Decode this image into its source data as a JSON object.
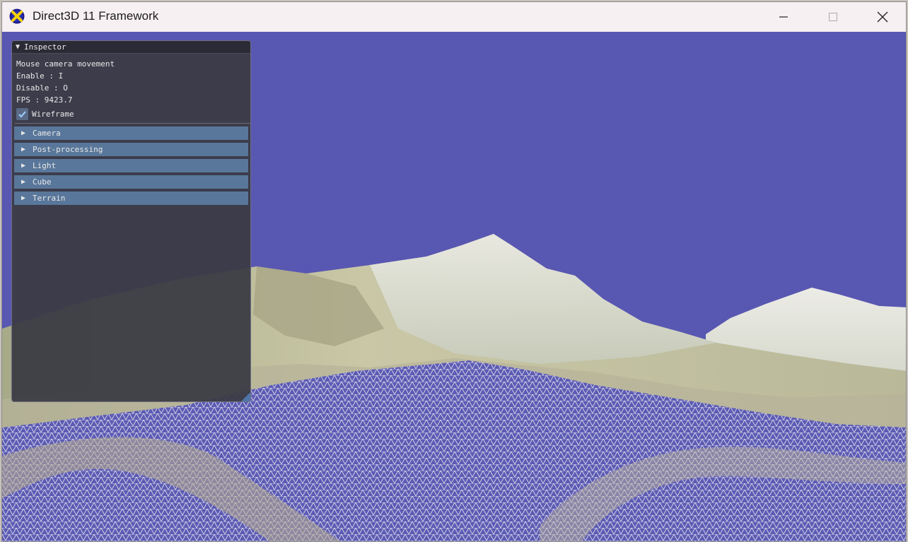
{
  "window": {
    "title": "Direct3D 11 Framework",
    "icon": "directx-x-icon",
    "controls": [
      "minimize-icon",
      "maximize-icon",
      "close-icon"
    ]
  },
  "colors": {
    "sky": "#5857b1",
    "titlebar": "#f7f0f3",
    "panel": "#3a3a44",
    "section": "#59779a"
  },
  "inspector": {
    "title": "Inspector",
    "lines": {
      "mouse": "Mouse camera movement",
      "enable": "Enable : I",
      "disable": "Disable : O",
      "fps": "FPS : 9423.7"
    },
    "wireframe": {
      "label": "Wireframe",
      "checked": true
    },
    "sections": [
      "Camera",
      "Post-processing",
      "Light",
      "Cube",
      "Terrain"
    ]
  }
}
